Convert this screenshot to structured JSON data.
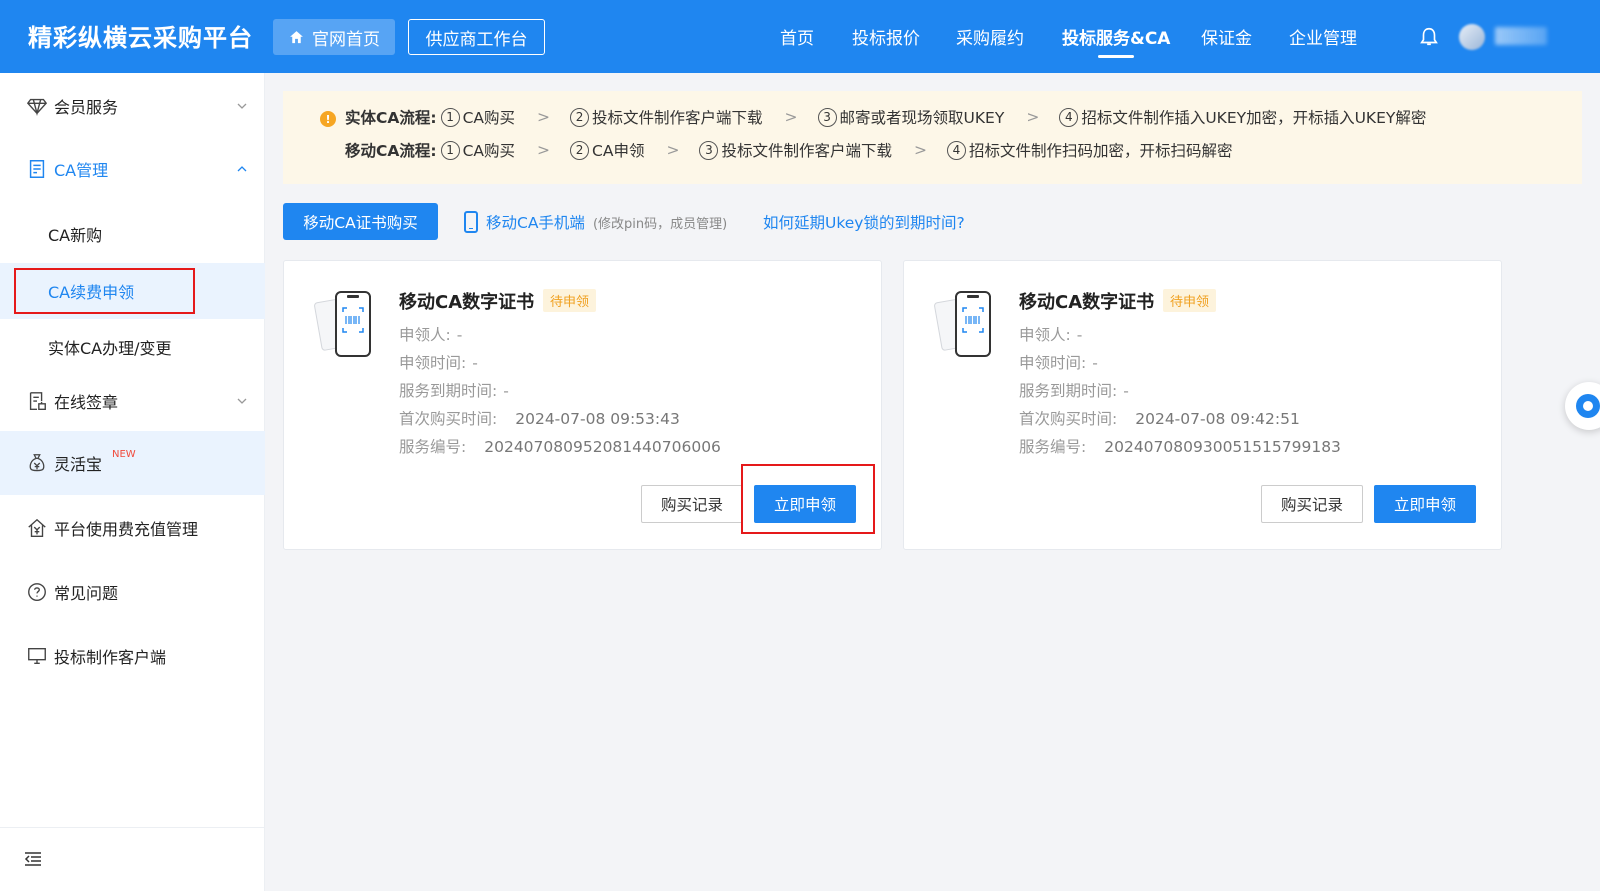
{
  "header": {
    "brand": "精彩纵横云采购平台",
    "home_label": "官网首页",
    "workbench_label": "供应商工作台",
    "nav": [
      "首页",
      "投标报价",
      "采购履约",
      "投标服务&CA",
      "保证金",
      "企业管理"
    ],
    "active_nav": "投标服务&CA"
  },
  "sidebar": {
    "member": "会员服务",
    "ca_manage": "CA管理",
    "ca_new": "CA新购",
    "ca_renew": "CA续费申领",
    "physical_ca": "实体CA办理/变更",
    "online_seal": "在线签章",
    "linghuobao": "灵活宝",
    "new_badge": "NEW",
    "platform_fee": "平台使用费充值管理",
    "faq": "常见问题",
    "client": "投标制作客户端"
  },
  "notice": {
    "physical_label": "实体CA流程:",
    "physical_steps": [
      "CA购买",
      "投标文件制作客户端下载",
      "邮寄或者现场领取UKEY",
      "招标文件制作插入UKEY加密，开标插入UKEY解密"
    ],
    "mobile_label": "移动CA流程:",
    "mobile_steps": [
      "CA购买",
      "CA申领",
      "投标文件制作客户端下载",
      "招标文件制作扫码加密，开标扫码解密"
    ],
    "step_numbers": [
      "1",
      "2",
      "3",
      "4"
    ]
  },
  "actions": {
    "buy_button": "移动CA证书购买",
    "mobile_link": "移动CA手机端",
    "mobile_link_note": "(修改pin码，成员管理)",
    "ukey_link": "如何延期Ukey锁的到期时间?"
  },
  "labels": {
    "applicant": "申领人:",
    "apply_time": "申领时间:",
    "expire_time": "服务到期时间:",
    "first_buy_time": "首次购买时间:",
    "service_no": "服务编号:",
    "record_button": "购买记录",
    "apply_button": "立即申领"
  },
  "cards": [
    {
      "title": "移动CA数字证书",
      "status": "待申领",
      "applicant": "-",
      "apply_time": "-",
      "expire_time": "-",
      "first_buy_time": "2024-07-08 09:53:43",
      "service_no": "202407080952081440706006"
    },
    {
      "title": "移动CA数字证书",
      "status": "待申领",
      "applicant": "-",
      "apply_time": "-",
      "expire_time": "-",
      "first_buy_time": "2024-07-08 09:42:51",
      "service_no": "202407080930051515799183"
    }
  ],
  "colors": {
    "primary": "#1f86f0",
    "highlight_border": "#e5191a",
    "notice_bg": "#fdf7e8",
    "tag_text": "#f0a020"
  }
}
